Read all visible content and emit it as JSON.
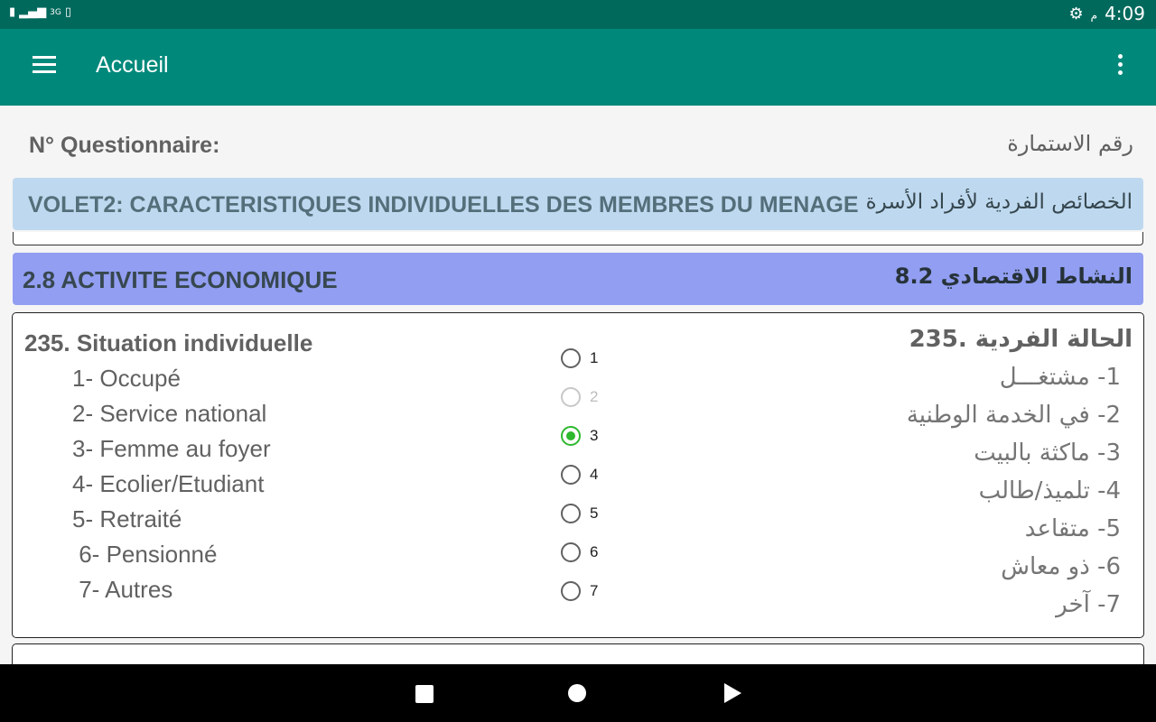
{
  "status_bar": {
    "signal_text": "3G",
    "time": "4:09",
    "ampm": "م"
  },
  "app_bar": {
    "title": "Accueil"
  },
  "questionnaire": {
    "label_fr": "N° Questionnaire:",
    "label_ar": "رقم الاستمارة"
  },
  "volet": {
    "title_fr": "VOLET2: CARACTERISTIQUES INDIVIDUELLES DES MEMBRES DU MENAGE",
    "title_ar": "الخصائص الفردية لأفراد الأسرة"
  },
  "section": {
    "title_fr": "2.8 ACTIVITE ECONOMIQUE",
    "title_ar": "8.2 النشاط الاقتصادي"
  },
  "question": {
    "title_fr": "235. Situation individuelle",
    "title_ar": "235. الحالة الفردية",
    "options_fr": [
      "1- Occupé",
      "2- Service national",
      "3- Femme au foyer",
      "4- Ecolier/Etudiant",
      "5- Retraité",
      " 6- Pensionné",
      " 7- Autres"
    ],
    "options_ar": [
      "1- مشتغـــل",
      "2-  في الخدمة الوطنية",
      "3- ماكثة بالبيت",
      "4- تلميذ/طالب",
      "5- متقاعد",
      "6- ذو معاش",
      "7- آخر"
    ],
    "radio_labels": [
      "1",
      "2",
      "3",
      "4",
      "5",
      "6",
      "7"
    ],
    "selected": "3",
    "disabled": [
      "2"
    ]
  }
}
